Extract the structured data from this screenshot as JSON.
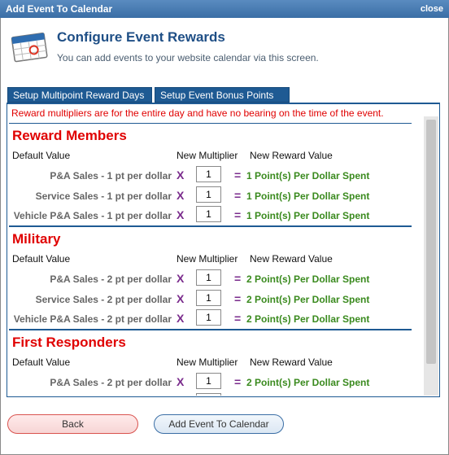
{
  "dialog": {
    "title": "Add Event To Calendar",
    "close_label": "close"
  },
  "header": {
    "title": "Configure Event Rewards",
    "subtitle": "You can add events to your website calendar via this screen."
  },
  "tabs": [
    {
      "label": "Setup Multipoint Reward Days"
    },
    {
      "label": "Setup Event Bonus Points"
    }
  ],
  "notice": "Reward multipliers are for the entire day and have no bearing on the time of the event.",
  "columns": {
    "default": "Default Value",
    "multiplier": "New Multiplier",
    "reward": "New Reward Value"
  },
  "operators": {
    "times": "X",
    "equals": "="
  },
  "sections": [
    {
      "title": "Reward Members",
      "rows": [
        {
          "default": "P&A Sales - 1 pt per dollar",
          "multiplier": "1",
          "result": "1 Point(s) Per Dollar Spent"
        },
        {
          "default": "Service Sales - 1 pt per dollar",
          "multiplier": "1",
          "result": "1 Point(s) Per Dollar Spent"
        },
        {
          "default": "Vehicle P&A Sales - 1 pt per dollar",
          "multiplier": "1",
          "result": "1 Point(s) Per Dollar Spent"
        }
      ]
    },
    {
      "title": "Military",
      "rows": [
        {
          "default": "P&A Sales - 2 pt per dollar",
          "multiplier": "1",
          "result": "2 Point(s) Per Dollar Spent"
        },
        {
          "default": "Service Sales - 2 pt per dollar",
          "multiplier": "1",
          "result": "2 Point(s) Per Dollar Spent"
        },
        {
          "default": "Vehicle P&A Sales - 2 pt per dollar",
          "multiplier": "1",
          "result": "2 Point(s) Per Dollar Spent"
        }
      ]
    },
    {
      "title": "First Responders",
      "rows": [
        {
          "default": "P&A Sales - 2 pt per dollar",
          "multiplier": "1",
          "result": "2 Point(s) Per Dollar Spent"
        }
      ]
    }
  ],
  "buttons": {
    "back": "Back",
    "add": "Add Event To Calendar"
  }
}
